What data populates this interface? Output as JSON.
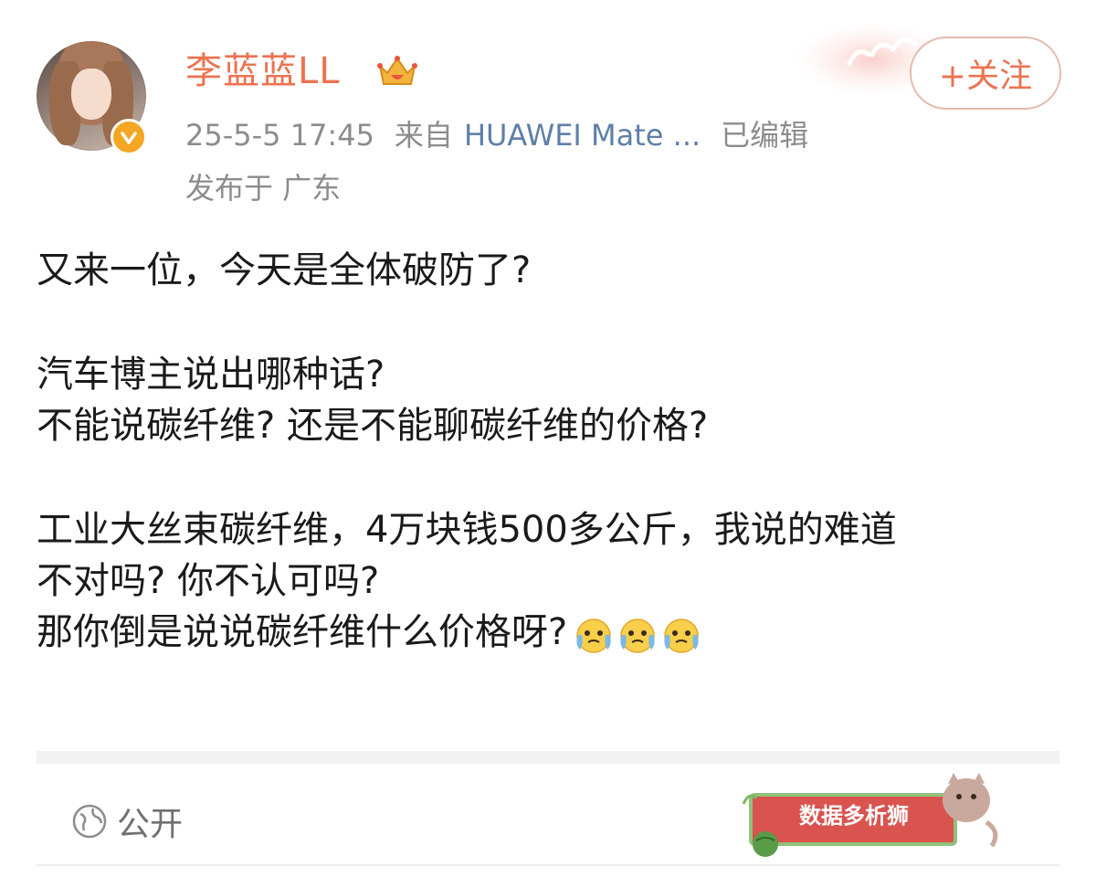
{
  "header": {
    "username": "李蓝蓝LL",
    "timestamp": "25-5-5 17:45",
    "source_prefix": "来自",
    "device": "HUAWEI Mate ...",
    "edited": "已编辑",
    "location": "发布于 广东",
    "follow_label": "+关注"
  },
  "post": {
    "lines": [
      "又来一位，今天是全体破防了?",
      "汽车博主说出哪种话?",
      "不能说碳纤维? 还是不能聊碳纤维的价格?",
      "工业大丝束碳纤维，4万块钱500多公斤，我说的难道",
      "不对吗? 你不认可吗?",
      "那你倒是说说碳纤维什么价格呀?"
    ],
    "emoji_names": [
      "crying-face-icon",
      "crying-face-icon",
      "crying-face-icon"
    ]
  },
  "footer": {
    "visibility": "公开"
  },
  "watermark": {
    "text": "数据多析狮"
  },
  "colors": {
    "username": "#eb7350",
    "meta": "#8c8c8c",
    "device": "#5f7fa8",
    "badge": "#f5a623"
  }
}
